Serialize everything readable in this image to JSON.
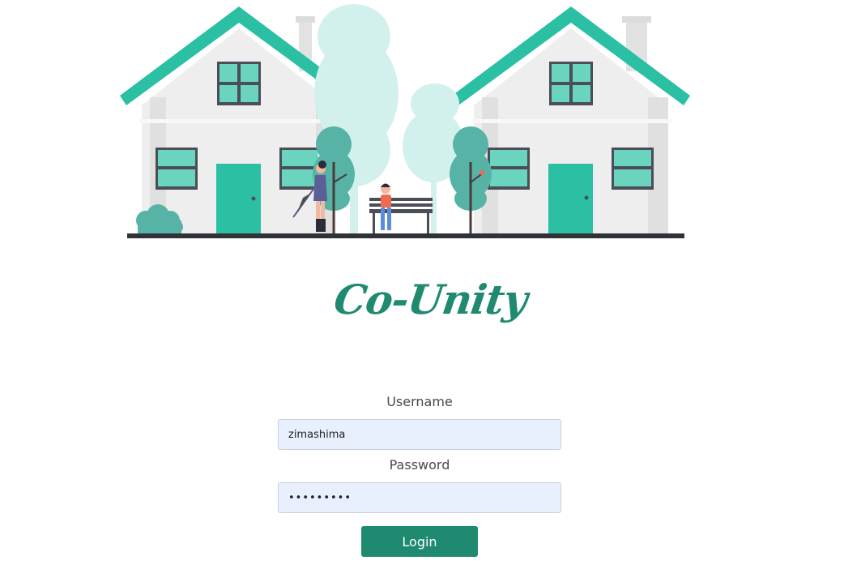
{
  "hero": {
    "illustration_icon": "houses-street-illustration"
  },
  "brand": {
    "title": "Co-Unity"
  },
  "form": {
    "username_label": "Username",
    "username_value": "zimashima",
    "password_label": "Password",
    "password_value": "•••••••••",
    "login_label": "Login"
  },
  "colors": {
    "accent": "#1f8a70",
    "roof": "#2bbfa4",
    "input_bg": "#e8f0fe"
  }
}
